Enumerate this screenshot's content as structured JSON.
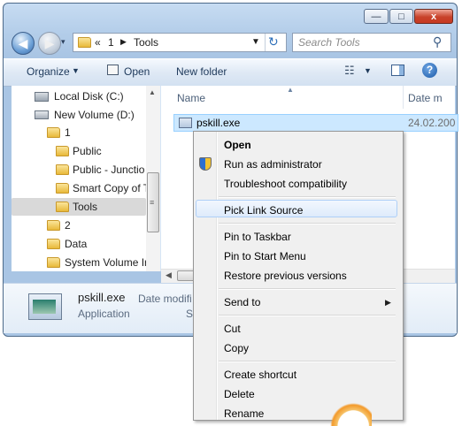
{
  "window": {
    "breadcrumb": [
      "«",
      "1",
      "Tools"
    ],
    "search_placeholder": "Search Tools",
    "caption": {
      "minimize": "—",
      "maximize": "□",
      "close": "x"
    }
  },
  "toolbar": {
    "organize": "Organize",
    "open": "Open",
    "new_folder": "New folder"
  },
  "nav_tree": [
    {
      "label": "Local Disk (C:)",
      "kind": "drive",
      "indent": 0
    },
    {
      "label": "New Volume (D:)",
      "kind": "drive",
      "indent": 0
    },
    {
      "label": "1",
      "kind": "folder",
      "indent": 1
    },
    {
      "label": "Public",
      "kind": "folder",
      "indent": 2
    },
    {
      "label": "Public - Junctio",
      "kind": "folder",
      "indent": 2
    },
    {
      "label": "Smart Copy of T",
      "kind": "folder",
      "indent": 2
    },
    {
      "label": "Tools",
      "kind": "folder",
      "indent": 2,
      "selected": true
    },
    {
      "label": "2",
      "kind": "folder",
      "indent": 1
    },
    {
      "label": "Data",
      "kind": "folder",
      "indent": 1
    },
    {
      "label": "System Volume Ir",
      "kind": "folder",
      "indent": 1
    }
  ],
  "columns": {
    "name": "Name",
    "date": "Date m"
  },
  "file": {
    "name": "pskill.exe",
    "date": "24.02.200"
  },
  "details": {
    "name": "pskill.exe",
    "type": "Application",
    "date_label": "Date modifi",
    "size_label": "Si"
  },
  "context_menu": {
    "items": [
      {
        "label": "Open",
        "bold": true
      },
      {
        "label": "Run as administrator",
        "icon": "shield-icon"
      },
      {
        "label": "Troubleshoot compatibility"
      },
      {
        "label": "Pick Link Source",
        "highlighted": true
      },
      {
        "label": "Pin to Taskbar"
      },
      {
        "label": "Pin to Start Menu"
      },
      {
        "label": "Restore previous versions"
      },
      {
        "label": "Send to",
        "submenu": true
      },
      {
        "label": "Cut"
      },
      {
        "label": "Copy"
      },
      {
        "label": "Create shortcut"
      },
      {
        "label": "Delete"
      },
      {
        "label": "Rename"
      }
    ]
  },
  "colors": {
    "accent": "#3c7fb1",
    "selection": "#cce8ff",
    "highlight_border": "#aecff7"
  }
}
